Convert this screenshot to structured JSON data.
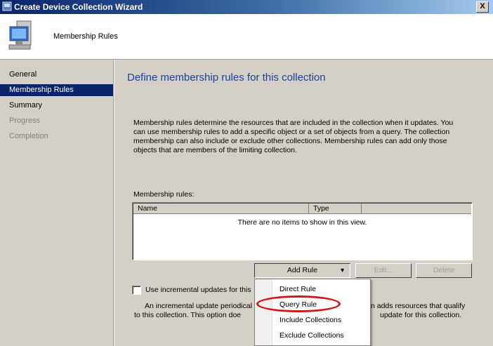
{
  "window": {
    "title": "Create Device Collection Wizard",
    "close_label": "X"
  },
  "header": {
    "title": "Membership Rules"
  },
  "nav": {
    "items": [
      {
        "label": "General",
        "state": "normal"
      },
      {
        "label": "Membership Rules",
        "state": "selected"
      },
      {
        "label": "Summary",
        "state": "normal"
      },
      {
        "label": "Progress",
        "state": "disabled"
      },
      {
        "label": "Completion",
        "state": "disabled"
      }
    ]
  },
  "main": {
    "heading": "Define membership rules for this collection",
    "description": "Membership rules determine the resources that are included in the collection when it updates. You can use membership rules to add a specific object or a set of objects from a query. The collection membership can also include or exclude other collections. Membership rules can add only those objects that are members of the limiting collection.",
    "rules_label": "Membership rules:",
    "list": {
      "columns": [
        "Name",
        "Type"
      ],
      "empty_message": "There are no items to show in this view."
    },
    "buttons": {
      "add_rule": "Add Rule",
      "edit": "Edit...",
      "delete": "Delete"
    },
    "incremental": {
      "checkbox_label": "Use incremental updates for this",
      "text_part1": "An incremental update periodical",
      "text_part2": "n adds resources that qualify",
      "text_line2a": "to this collection. This option doe",
      "text_line2b": "update for this collection."
    },
    "menu": {
      "items": [
        "Direct Rule",
        "Query Rule",
        "Include Collections",
        "Exclude Collections"
      ]
    }
  },
  "colors": {
    "accent": "#0a246a",
    "heading": "#1f3f9f",
    "highlight": "#d01818"
  }
}
